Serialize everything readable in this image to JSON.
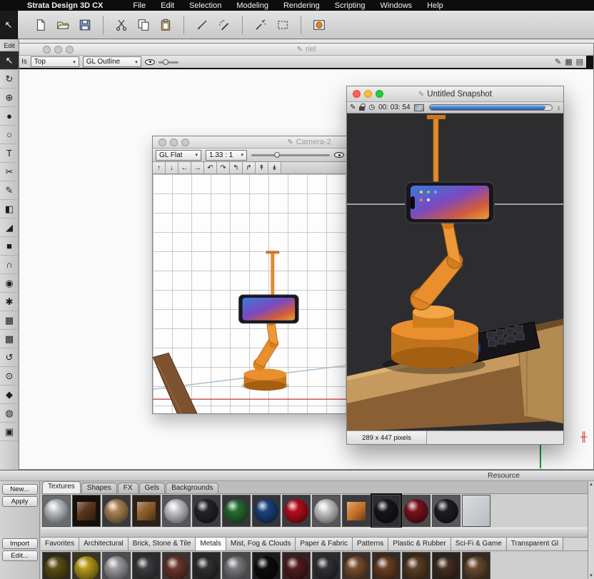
{
  "menu_bar": {
    "app_name": "Strata Design 3D CX",
    "items": [
      "File",
      "Edit",
      "Selection",
      "Modeling",
      "Rendering",
      "Scripting",
      "Windows",
      "Help"
    ]
  },
  "toolbar": {
    "groups": [
      [
        "new-document",
        "open-file",
        "save-file"
      ],
      [
        "cut",
        "copy",
        "paste"
      ],
      [
        "pen",
        "airbrush"
      ],
      [
        "wand",
        "marquee"
      ],
      [
        "render"
      ]
    ]
  },
  "tool_palette": {
    "label": "Edit",
    "active_tool": "select-arrow",
    "tools": [
      "select-arrow",
      "rotate-tool",
      "move-tool",
      "sphere-tool",
      "bezier-tool",
      "text-tool",
      "knife-tool",
      "pen-tool",
      "fill-tool",
      "eyedropper-tool",
      "cube-tool",
      "magnet-tool",
      "target-tool",
      "star-tool",
      "grid-tool",
      "pattern-tool",
      "orbit-tool",
      "zoom-tool",
      "solid-tool",
      "lamp-tool",
      "camera-tool"
    ]
  },
  "riel_window": {
    "title": "riel",
    "view_label": "Is",
    "view_dropdown": "Top",
    "render_dropdown": "GL Outline"
  },
  "camera_window": {
    "title": "Camera-2",
    "render_dropdown": "GL Flat",
    "aspect_ratio": "1.33 : 1",
    "nav_buttons": [
      "pan-up",
      "pan-down",
      "pan-left",
      "pan-right",
      "orbit-left",
      "orbit-right",
      "roll-left",
      "roll-right",
      "zoom-in",
      "zoom-out"
    ]
  },
  "snapshot_window": {
    "title": "Untitled Snapshot",
    "elapsed_time": "00: 03: 54",
    "render_progress_percent": 95,
    "size_label": "289 x 447 pixels"
  },
  "resource_panel": {
    "title": "Resource",
    "tabs": [
      "Textures",
      "Shapes",
      "FX",
      "Gels",
      "Backgrounds"
    ],
    "active_tab": "Textures",
    "buttons_top": [
      "New...",
      "Apply"
    ],
    "buttons_bottom": [
      "Import",
      "Edit..."
    ],
    "categories": [
      "Favorites",
      "Architectural",
      "Brick, Stone & Tile",
      "Metals",
      "Mist, Fog & Clouds",
      "Paper & Fabric",
      "Patterns",
      "Plastic & Rubber",
      "Sci-Fi & Game",
      "Transparent Gl"
    ],
    "active_category": "Metals",
    "texture_swatches": [
      {
        "type": "sphere",
        "bg": "#6a6a6e",
        "color": "#e2e6ea"
      },
      {
        "type": "cube",
        "bg": "#15100b",
        "color": "#57331a"
      },
      {
        "type": "sphere",
        "bg": "#3a3a3c",
        "color": "#c89a62"
      },
      {
        "type": "cube",
        "bg": "#2a2118",
        "color": "#8a5a28"
      },
      {
        "type": "sphere",
        "bg": "#55555a",
        "color": "#ececf0"
      },
      {
        "type": "sphere",
        "bg": "#3c3c40",
        "color": "#2a2a2e"
      },
      {
        "type": "sphere",
        "bg": "#36363a",
        "color": "#2f7d3c"
      },
      {
        "type": "sphere",
        "bg": "#34343a",
        "color": "#1e4e8e"
      },
      {
        "type": "sphere",
        "bg": "#3a3a3e",
        "color": "#cf1020"
      },
      {
        "type": "sphere",
        "bg": "#55555a",
        "color": "#f0f0f2"
      },
      {
        "type": "cube",
        "bg": "#3a3a3e",
        "color": "#c9742a"
      },
      {
        "type": "sphere",
        "bg": "#2e2e32",
        "color": "#1a1a1e",
        "selected": true
      },
      {
        "type": "sphere",
        "bg": "#4a4a4e",
        "color": "#8c1622"
      },
      {
        "type": "sphere",
        "bg": "#58585c",
        "color": "#232327"
      },
      {
        "type": "flat",
        "bg": "#b9bdc1",
        "color": "#d8dcdf"
      }
    ],
    "metal_swatches": [
      {
        "type": "sphere",
        "bg": "#2e2a20",
        "color": "#6b5c16"
      },
      {
        "type": "sphere",
        "bg": "#3a3420",
        "color": "#d2b31e"
      },
      {
        "type": "sphere",
        "bg": "#4e4e52",
        "color": "#b6b6ba"
      },
      {
        "type": "sphere",
        "bg": "#2c2c2e",
        "color": "#47474b"
      },
      {
        "type": "sphere",
        "bg": "#3e3230",
        "color": "#7c4034"
      },
      {
        "type": "sphere",
        "bg": "#28282a",
        "color": "#39393d"
      },
      {
        "type": "sphere",
        "bg": "#4a4a4e",
        "color": "#8e8e92"
      },
      {
        "type": "sphere",
        "bg": "#1c1c1e",
        "color": "#0e0e10"
      },
      {
        "type": "sphere",
        "bg": "#342022",
        "color": "#5e2024"
      },
      {
        "type": "sphere",
        "bg": "#2c2c2e",
        "color": "#3a3a3e"
      },
      {
        "type": "sphere",
        "bg": "#3c3028",
        "color": "#8a5a38"
      },
      {
        "type": "sphere",
        "bg": "#362a22",
        "color": "#7a4a2a"
      },
      {
        "type": "sphere",
        "bg": "#32281e",
        "color": "#6a4a2c"
      },
      {
        "type": "sphere",
        "bg": "#2a221c",
        "color": "#503626"
      },
      {
        "type": "sphere",
        "bg": "#342a20",
        "color": "#785737"
      }
    ]
  }
}
